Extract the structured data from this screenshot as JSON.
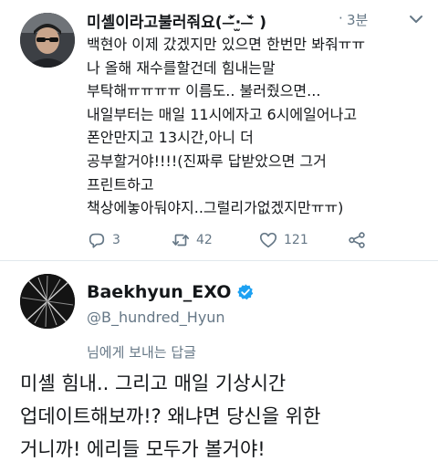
{
  "tweet": {
    "display_name": "미셸이라고불러줘요( ˃̶᷄‧̫ ˂̶᷅ )",
    "time_separator": "·",
    "time": "3분",
    "text_lines": [
      "백현아 이제 갔겠지만 있으면 한번만 봐줘ㅠㅠ",
      "나 올해 재수를할건데 힘내는말",
      "부탁해ㅠㅠㅠㅠ 이름도.. 불러줬으면...",
      "내일부터는 매일 11시에자고 6시에일어나고",
      "폰안만지고 13시간,아니 더",
      "공부할거야!!!!(진짜루 답받았으면 그거",
      "프린트하고",
      "책상에놓아둬야지..그럴리가없겠지만ㅠㅠ)"
    ],
    "actions": {
      "reply_count": "3",
      "retweet_count": "42",
      "like_count": "121"
    },
    "icons": [
      "reply-icon",
      "retweet-icon",
      "like-icon",
      "share-icon",
      "chevron-down-icon"
    ]
  },
  "reply": {
    "display_name": "Baekhyun_EXO",
    "handle": "@B_hundred_Hyun",
    "replying_to": "님에게 보내는 답글",
    "text_lines": [
      "미셸 힘내.. 그리고 매일 기상시간",
      "업데이트해보까!? 왜냐면 당신을 위한",
      "거니까! 에리들 모두가 볼거야!"
    ],
    "verified_color": "#1da1f2"
  },
  "colors": {
    "text": "#14171a",
    "secondary": "#657786",
    "divider": "#e1e8ed"
  }
}
